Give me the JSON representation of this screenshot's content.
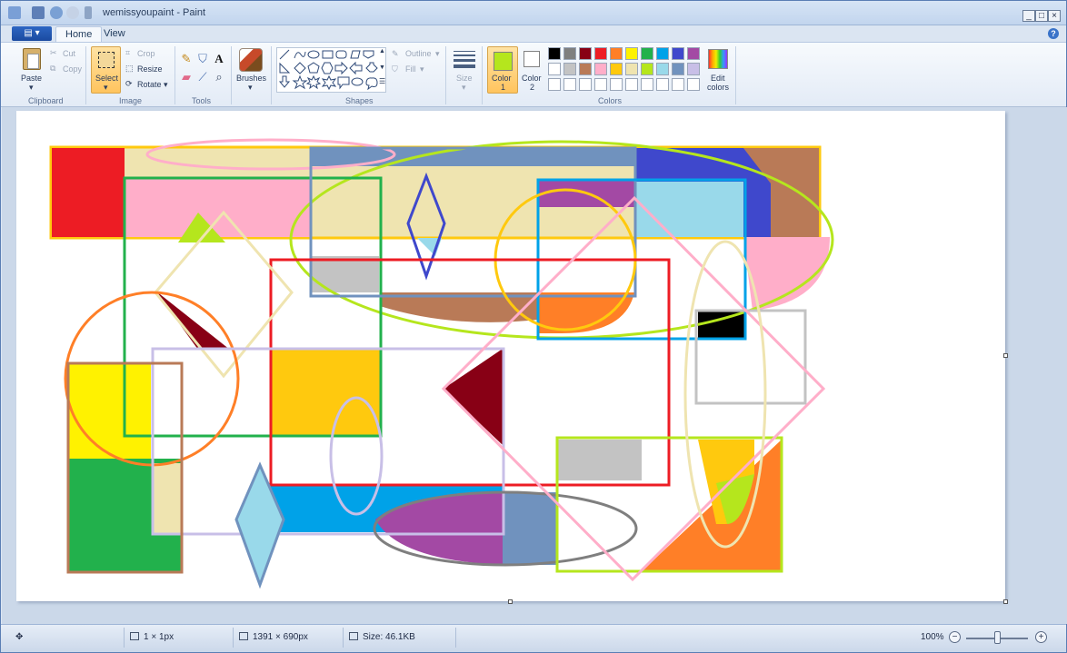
{
  "window": {
    "title": "wemissyoupaint - Paint"
  },
  "tabs": {
    "home": "Home",
    "view": "View"
  },
  "ribbon": {
    "clipboard": {
      "paste": "Paste",
      "cut": "Cut",
      "copy": "Copy",
      "label": "Clipboard"
    },
    "image": {
      "select": "Select",
      "crop": "Crop",
      "resize": "Resize",
      "rotate": "Rotate",
      "label": "Image"
    },
    "tools": {
      "label": "Tools",
      "text_tool": "A"
    },
    "brushes": {
      "label": "Brushes"
    },
    "shapes": {
      "outline": "Outline",
      "fill": "Fill",
      "label": "Shapes"
    },
    "size": {
      "label": "Size"
    },
    "colors": {
      "color1_line1": "Color",
      "color1_line2": "1",
      "color2_line1": "Color",
      "color2_line2": "2",
      "edit_line1": "Edit",
      "edit_line2": "colors",
      "label": "Colors"
    }
  },
  "palette": {
    "row1": [
      "#000000",
      "#7f7f7f",
      "#880015",
      "#ed1c24",
      "#ff7f27",
      "#fff200",
      "#22b14c",
      "#00a2e8",
      "#3f48cc",
      "#a349a4"
    ],
    "row2": [
      "#ffffff",
      "#c3c3c3",
      "#b97a57",
      "#ffaec9",
      "#ffc90e",
      "#efe4b0",
      "#b5e61d",
      "#99d9ea",
      "#7092be",
      "#c8bfe7"
    ]
  },
  "status": {
    "pixel_size": "1 × 1px",
    "image_size": "1391 × 690px",
    "file_size": "Size: 46.1KB",
    "zoom": "100%"
  },
  "colors": {
    "current_color1": "#b5e61d",
    "current_color2": "#ffffff"
  }
}
